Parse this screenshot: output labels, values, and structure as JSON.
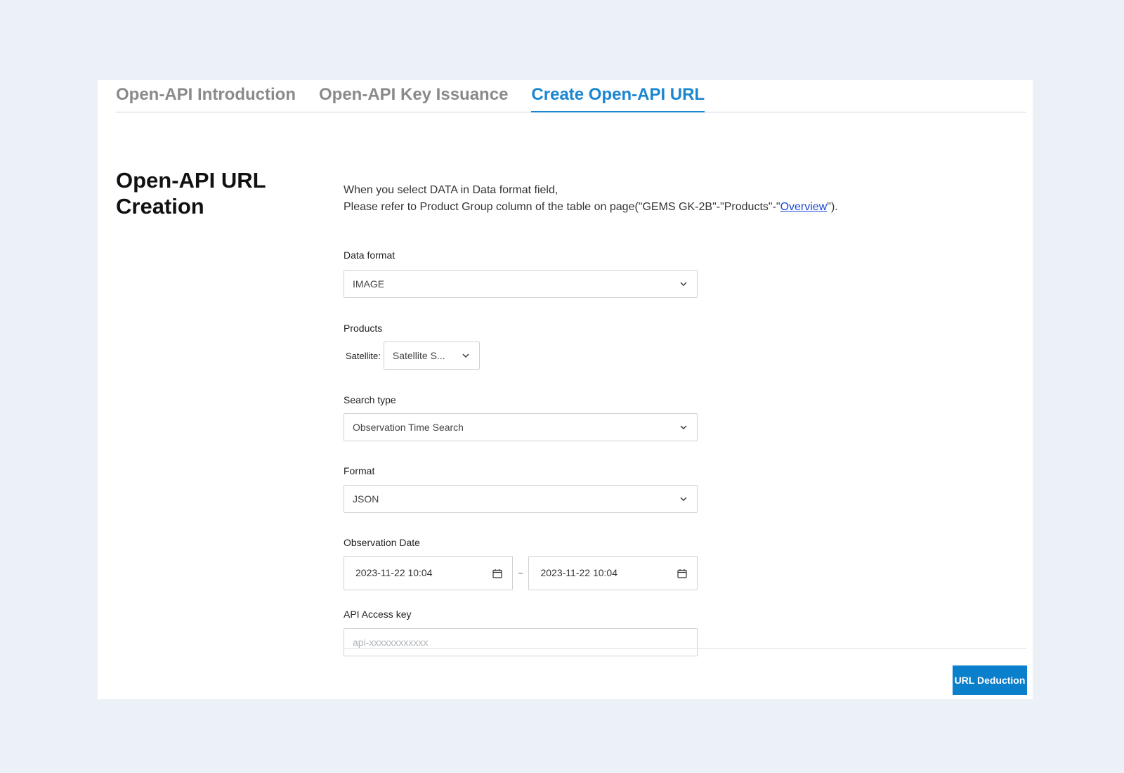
{
  "tabs": [
    {
      "label": "Open-API Introduction",
      "active": false
    },
    {
      "label": "Open-API Key Issuance",
      "active": false
    },
    {
      "label": "Create Open-API URL",
      "active": true
    }
  ],
  "section": {
    "title": "Open-API URL Creation"
  },
  "notice": {
    "line1": "When you select DATA in Data format field,",
    "line2_prefix": "Please refer to Product Group column of the table on page(\"GEMS GK-2B\"-\"Products\"-\"",
    "link_text": "Overview",
    "line2_suffix": "\")."
  },
  "form": {
    "data_format": {
      "label": "Data format",
      "value": "IMAGE"
    },
    "products": {
      "label": "Products",
      "satellite_label": "Satellite:",
      "satellite_value": "Satellite S..."
    },
    "search_type": {
      "label": "Search type",
      "value": "Observation Time Search"
    },
    "format": {
      "label": "Format",
      "value": "JSON"
    },
    "observation_date": {
      "label": "Observation Date",
      "start": "2023-11-22 10:04",
      "separator": "~",
      "end": "2023-11-22 10:04"
    },
    "api_key": {
      "label": "API Access key",
      "placeholder": "api-xxxxxxxxxxxx",
      "value": ""
    }
  },
  "actions": {
    "url_deduction_label": "URL Deduction"
  },
  "colors": {
    "accent": "#1a86d0",
    "button": "#0a7fcc",
    "page_bg": "#ecf0f7",
    "link": "#1a47d9"
  },
  "icons": {
    "dropdown": "chevron-down-icon",
    "date": "calendar-icon"
  }
}
